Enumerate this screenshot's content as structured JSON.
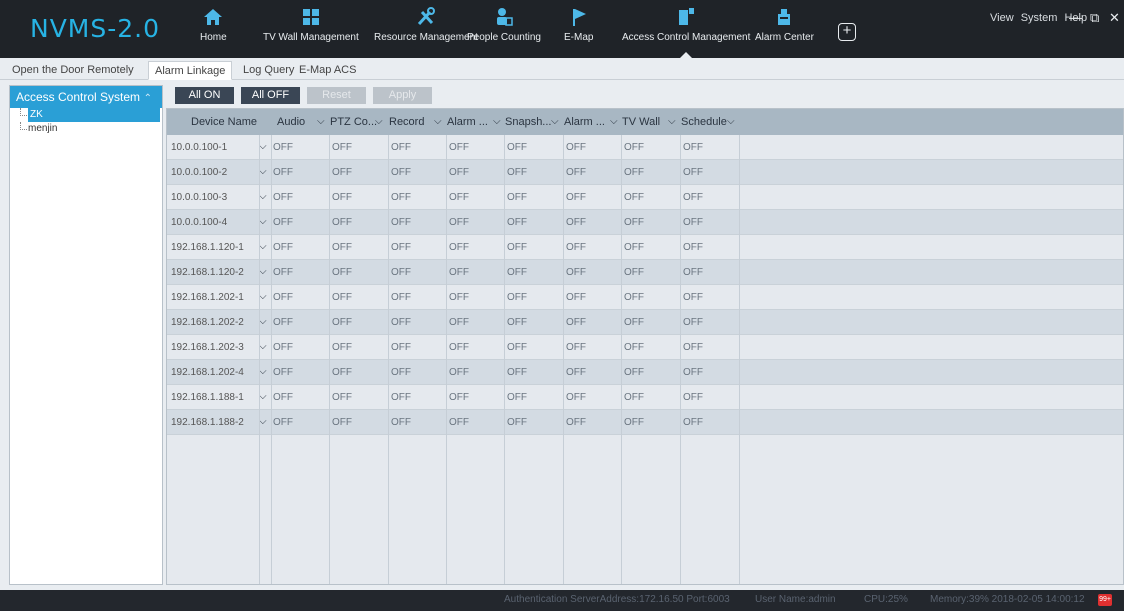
{
  "app": {
    "logo": "NVMS-2.0"
  },
  "nav": [
    {
      "id": "home",
      "label": "Home",
      "icon": "home-icon"
    },
    {
      "id": "tvwall",
      "label": "TV Wall Management",
      "icon": "tv-wall-icon"
    },
    {
      "id": "resource",
      "label": "Resource Management",
      "icon": "tools-icon"
    },
    {
      "id": "people",
      "label": "People Counting",
      "icon": "people-counting-icon"
    },
    {
      "id": "emap",
      "label": "E-Map",
      "icon": "map-flag-icon"
    },
    {
      "id": "access",
      "label": "Access Control Management",
      "icon": "access-control-icon",
      "active": true
    },
    {
      "id": "alarm",
      "label": "Alarm Center",
      "icon": "alarm-center-icon"
    }
  ],
  "window_menu": {
    "view": "View",
    "system": "System",
    "help": "Help"
  },
  "tabs": [
    {
      "label": "Open the Door Remotely"
    },
    {
      "label": "Alarm Linkage",
      "active": true
    },
    {
      "label": "Log Query"
    },
    {
      "label": "E-Map ACS"
    }
  ],
  "sidebar": {
    "title": "Access Control System",
    "items": [
      {
        "label": "ZK",
        "selected": true
      },
      {
        "label": "menjin"
      }
    ]
  },
  "toolbar": {
    "all_on": "All ON",
    "all_off": "All OFF",
    "reset": "Reset",
    "apply": "Apply"
  },
  "table": {
    "columns": [
      "Device Name",
      "Audio",
      "PTZ Co...",
      "Record",
      "Alarm ...",
      "Snapsh...",
      "Alarm ...",
      "TV Wall",
      "Schedule"
    ],
    "rows": [
      {
        "name": "10.0.0.100-1",
        "values": [
          "OFF",
          "OFF",
          "OFF",
          "OFF",
          "OFF",
          "OFF",
          "OFF",
          "OFF"
        ]
      },
      {
        "name": "10.0.0.100-2",
        "values": [
          "OFF",
          "OFF",
          "OFF",
          "OFF",
          "OFF",
          "OFF",
          "OFF",
          "OFF"
        ]
      },
      {
        "name": "10.0.0.100-3",
        "values": [
          "OFF",
          "OFF",
          "OFF",
          "OFF",
          "OFF",
          "OFF",
          "OFF",
          "OFF"
        ]
      },
      {
        "name": "10.0.0.100-4",
        "values": [
          "OFF",
          "OFF",
          "OFF",
          "OFF",
          "OFF",
          "OFF",
          "OFF",
          "OFF"
        ]
      },
      {
        "name": "192.168.1.120-1",
        "values": [
          "OFF",
          "OFF",
          "OFF",
          "OFF",
          "OFF",
          "OFF",
          "OFF",
          "OFF"
        ]
      },
      {
        "name": "192.168.1.120-2",
        "values": [
          "OFF",
          "OFF",
          "OFF",
          "OFF",
          "OFF",
          "OFF",
          "OFF",
          "OFF"
        ]
      },
      {
        "name": "192.168.1.202-1",
        "values": [
          "OFF",
          "OFF",
          "OFF",
          "OFF",
          "OFF",
          "OFF",
          "OFF",
          "OFF"
        ]
      },
      {
        "name": "192.168.1.202-2",
        "values": [
          "OFF",
          "OFF",
          "OFF",
          "OFF",
          "OFF",
          "OFF",
          "OFF",
          "OFF"
        ]
      },
      {
        "name": "192.168.1.202-3",
        "values": [
          "OFF",
          "OFF",
          "OFF",
          "OFF",
          "OFF",
          "OFF",
          "OFF",
          "OFF"
        ]
      },
      {
        "name": "192.168.1.202-4",
        "values": [
          "OFF",
          "OFF",
          "OFF",
          "OFF",
          "OFF",
          "OFF",
          "OFF",
          "OFF"
        ]
      },
      {
        "name": "192.168.1.188-1",
        "values": [
          "OFF",
          "OFF",
          "OFF",
          "OFF",
          "OFF",
          "OFF",
          "OFF",
          "OFF"
        ]
      },
      {
        "name": "192.168.1.188-2",
        "values": [
          "OFF",
          "OFF",
          "OFF",
          "OFF",
          "OFF",
          "OFF",
          "OFF",
          "OFF"
        ]
      }
    ]
  },
  "status": {
    "auth": "Authentication ServerAddress:172.16.50 Port:6003",
    "user": "User Name:admin",
    "cpu": "CPU:25%",
    "memory": "Memory:39% 2018-02-05 14:00:12",
    "badge": "99+"
  },
  "colors": {
    "accent": "#2a9fd6",
    "header_bg": "#1f2328",
    "logo": "#27b3e4"
  }
}
